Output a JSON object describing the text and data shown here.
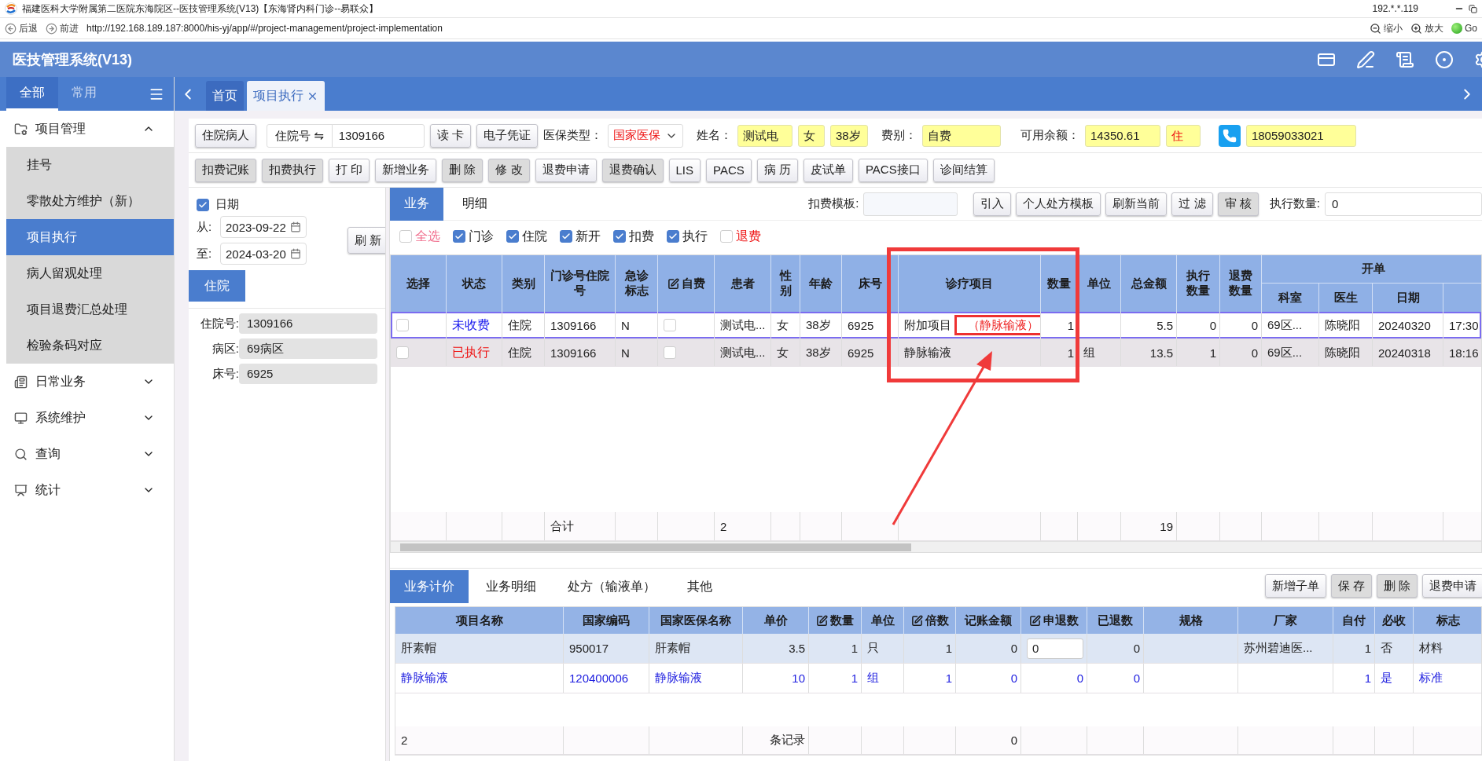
{
  "browser": {
    "title": "福建医科大学附属第二医院东海院区--医技管理系统(V13)【东海肾内科门诊--易联众】",
    "host": "192.*.*.119",
    "back": "后退",
    "forward": "前进",
    "url": "http://192.168.189.187:8000/his-yj/app/#/project-management/project-implementation",
    "zoom_out": "缩小",
    "zoom_in": "放大",
    "go": "Go"
  },
  "app_header": {
    "title": "医技管理系统(V13)"
  },
  "sidebar": {
    "tabs": [
      {
        "label": "全部",
        "selected": true
      },
      {
        "label": "常用",
        "selected": false
      }
    ],
    "items": [
      {
        "label": "项目管理",
        "expanded": true,
        "children": [
          {
            "label": "挂号",
            "selected": false
          },
          {
            "label": "零散处方维护（新）",
            "selected": false
          },
          {
            "label": "项目执行",
            "selected": true
          },
          {
            "label": "病人留观处理",
            "selected": false
          },
          {
            "label": "项目退费汇总处理",
            "selected": false
          },
          {
            "label": "检验条码对应",
            "selected": false
          }
        ]
      },
      {
        "label": "日常业务",
        "expanded": false
      },
      {
        "label": "系统维护",
        "expanded": false
      },
      {
        "label": "查询",
        "expanded": false
      },
      {
        "label": "统计",
        "expanded": false
      }
    ]
  },
  "page_tabs": [
    {
      "label": "首页",
      "selected": false,
      "closable": false
    },
    {
      "label": "项目执行",
      "selected": true,
      "closable": true
    }
  ],
  "patient_bar": {
    "inpatient_button": "住院病人",
    "id_label": "住院号 ⇋",
    "id_value": "1309166",
    "buttons": [
      "读 卡",
      "电子凭证"
    ],
    "insurance_label": "医保类型：",
    "insurance_value": "国家医保",
    "name_label": "姓名：",
    "name": "测试电",
    "gender": "女",
    "age": "38岁",
    "fee_label": "费别：",
    "fee": "自费",
    "balance_label": "可用余额：",
    "balance": "14350.61",
    "visit_type": "住",
    "phone": "18059033021"
  },
  "toolbar": [
    {
      "label": "扣费记账",
      "shaded": true
    },
    {
      "label": "扣费执行",
      "shaded": true
    },
    {
      "label": "打 印",
      "shaded": false
    },
    {
      "label": "新增业务",
      "shaded": false
    },
    {
      "label": "删 除",
      "shaded": true
    },
    {
      "label": "修 改",
      "shaded": true
    },
    {
      "label": "退费申请",
      "shaded": false
    },
    {
      "label": "退费确认",
      "shaded": true
    },
    {
      "label": "LIS",
      "shaded": false
    },
    {
      "label": "PACS",
      "shaded": false
    },
    {
      "label": "病 历",
      "shaded": false
    },
    {
      "label": "皮试单",
      "shaded": false
    },
    {
      "label": "PACS接口",
      "shaded": false
    },
    {
      "label": "诊间结算",
      "shaded": false
    }
  ],
  "filter_panel": {
    "date_label": "日期",
    "date_checked": true,
    "from_label": "从:",
    "from": "2023-09-22",
    "to_label": "至:",
    "to": "2024-03-20",
    "refresh": "刷 新",
    "section": "住院",
    "fields": [
      {
        "label": "住院号:",
        "value": "1309166"
      },
      {
        "label": "病区:",
        "value": "69病区"
      },
      {
        "label": "床号:",
        "value": "6925"
      }
    ]
  },
  "business_panel": {
    "tabs": [
      {
        "label": "业务",
        "selected": true
      },
      {
        "label": "明细",
        "selected": false
      }
    ],
    "template_label": "扣费模板:",
    "buttons": [
      {
        "label": "引入",
        "shaded": false
      },
      {
        "label": "个人处方模板",
        "shaded": false
      },
      {
        "label": "刷新当前",
        "shaded": false
      },
      {
        "label": "过 滤",
        "shaded": false
      },
      {
        "label": "审 核",
        "shaded": true
      }
    ],
    "exec_label": "执行数量:",
    "exec_value": "0",
    "filters": [
      {
        "label": "全选",
        "checked": false,
        "color": "#f06a8a"
      },
      {
        "label": "门诊",
        "checked": true,
        "color": "#222222"
      },
      {
        "label": "住院",
        "checked": true,
        "color": "#222222"
      },
      {
        "label": "新开",
        "checked": true,
        "color": "#222222"
      },
      {
        "label": "扣费",
        "checked": true,
        "color": "#222222"
      },
      {
        "label": "执行",
        "checked": true,
        "color": "#222222"
      },
      {
        "label": "退费",
        "checked": false,
        "color": "#ee1111"
      }
    ],
    "grid": {
      "columns": [
        {
          "label": "选择",
          "editable": false
        },
        {
          "label": "状态",
          "editable": false
        },
        {
          "label": "类别",
          "editable": false
        },
        {
          "label": "门诊号住院号",
          "editable": false,
          "total": "合计"
        },
        {
          "label": "急诊标志",
          "editable": false
        },
        {
          "label": "自费",
          "editable": true
        },
        {
          "label": "患者",
          "editable": false,
          "total": "2"
        },
        {
          "label": "性别",
          "editable": false
        },
        {
          "label": "年龄",
          "editable": false
        },
        {
          "label": "床号",
          "editable": false
        },
        {
          "label": "诊疗项目",
          "editable": false
        },
        {
          "label": "数量",
          "editable": false
        },
        {
          "label": "单位",
          "editable": false
        },
        {
          "label": "总金额",
          "editable": false,
          "total": "19"
        },
        {
          "label": "执行数量",
          "editable": false
        },
        {
          "label": "退费数量",
          "editable": false
        }
      ],
      "column_group": {
        "label": "开单",
        "columns": [
          {
            "label": "科室"
          },
          {
            "label": "医生"
          },
          {
            "label": "日期"
          }
        ]
      },
      "rows": [
        {
          "selected": true,
          "cells": [
            {
              "kind": "checkbox",
              "checked": false
            },
            {
              "kind": "status",
              "text": "未收费",
              "color": "#1a1aee"
            },
            "住院",
            "1309166",
            "N",
            {
              "kind": "checkbox",
              "checked": false
            },
            "测试电...",
            "女",
            "38岁",
            "6925",
            {
              "kind": "tagged",
              "text": "附加项目",
              "tag": "（静脉输液）"
            },
            "1",
            {
              "kind": "blank"
            },
            "5.5",
            "0",
            "0",
            "69区...",
            "陈晓阳",
            "20240320",
            "17:30"
          ]
        },
        {
          "selected": false,
          "cells": [
            {
              "kind": "checkbox",
              "checked": false
            },
            {
              "kind": "status",
              "text": "已执行",
              "color": "#ee1111"
            },
            "住院",
            "1309166",
            "N",
            {
              "kind": "checkbox",
              "checked": false
            },
            "测试电...",
            "女",
            "38岁",
            "6925",
            "静脉输液",
            "1",
            "组",
            "13.5",
            "1",
            "0",
            "69区...",
            "陈晓阳",
            "20240318",
            "18:16"
          ]
        }
      ]
    }
  },
  "detail_panel": {
    "tabs": [
      {
        "label": "业务计价",
        "selected": true
      },
      {
        "label": "业务明细",
        "selected": false
      },
      {
        "label": "处方（输液单）",
        "selected": false
      },
      {
        "label": "其他",
        "selected": false
      }
    ],
    "buttons": [
      {
        "label": "新增子单",
        "shaded": false
      },
      {
        "label": "保 存",
        "shaded": true
      },
      {
        "label": "删 除",
        "shaded": true
      },
      {
        "label": "退费申请",
        "shaded": false
      }
    ],
    "grid": {
      "columns": [
        {
          "label": "项目名称",
          "editable": false,
          "total": "2"
        },
        {
          "label": "国家编码",
          "editable": false
        },
        {
          "label": "国家医保名称",
          "editable": false
        },
        {
          "label": "单价",
          "editable": false,
          "total": "条记录"
        },
        {
          "label": "数量",
          "editable": true
        },
        {
          "label": "单位",
          "editable": false
        },
        {
          "label": "倍数",
          "editable": true
        },
        {
          "label": "记账金额",
          "editable": false,
          "total": "0"
        },
        {
          "label": "申退数",
          "editable": true
        },
        {
          "label": "已退数",
          "editable": false
        },
        {
          "label": "规格",
          "editable": false
        },
        {
          "label": "厂家",
          "editable": false
        },
        {
          "label": "自付",
          "editable": false
        },
        {
          "label": "必收",
          "editable": false
        },
        {
          "label": "标志",
          "editable": false
        }
      ],
      "rows": [
        {
          "selected": true,
          "emphasized": false,
          "cells": [
            "肝素帽",
            "950017",
            "肝素帽",
            "3.5",
            "1",
            "只",
            "1",
            "0",
            {
              "kind": "input",
              "value": "0"
            },
            "0",
            {
              "kind": "blank"
            },
            "苏州碧迪医...",
            "1",
            "否",
            "材料"
          ]
        },
        {
          "selected": false,
          "emphasized": true,
          "cells": [
            "静脉输液",
            "120400006",
            "静脉输液",
            "10",
            "1",
            "组",
            "1",
            "0",
            "0",
            "0",
            {
              "kind": "blank"
            },
            {
              "kind": "blank"
            },
            "1",
            "是",
            "标准"
          ]
        }
      ]
    }
  }
}
